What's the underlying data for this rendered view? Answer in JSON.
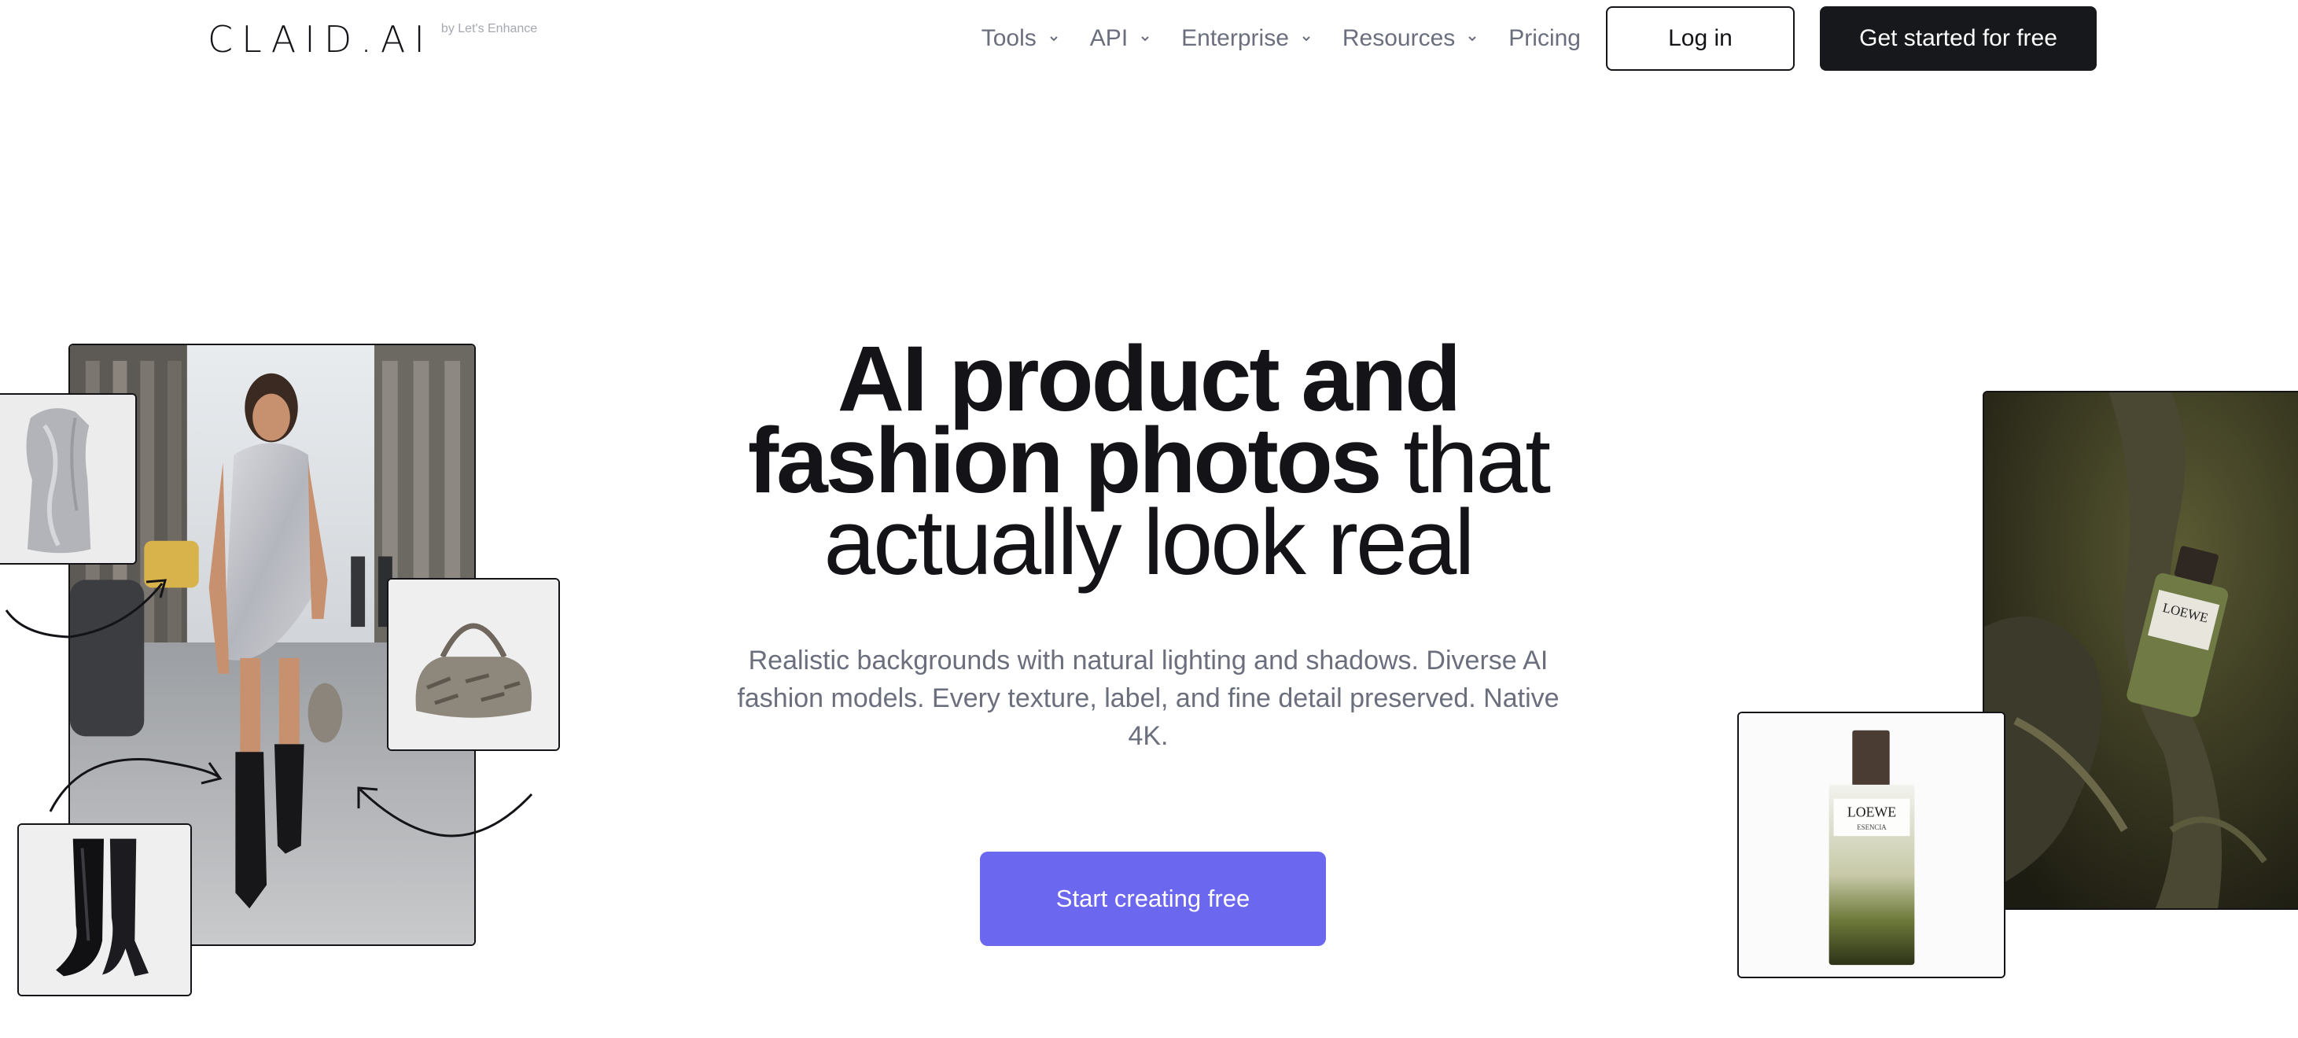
{
  "header": {
    "logo_text": "CLAID.AI",
    "logo_sub": "by Let's Enhance",
    "nav": [
      {
        "label": "Tools",
        "has_dropdown": true
      },
      {
        "label": "API",
        "has_dropdown": true
      },
      {
        "label": "Enterprise",
        "has_dropdown": true
      },
      {
        "label": "Resources",
        "has_dropdown": true
      },
      {
        "label": "Pricing",
        "has_dropdown": false
      }
    ],
    "login_label": "Log in",
    "get_started_label": "Get started for free"
  },
  "hero": {
    "title_bold_1": "AI product and",
    "title_bold_2": "fashion photos",
    "title_light_2": " that",
    "title_light_3": "actually look real",
    "subtitle": "Realistic backgrounds with natural lighting and shadows. Diverse AI fashion models. Every texture, label, and fine detail preserved. Native 4K.",
    "cta_label": "Start creating free"
  },
  "images": {
    "perfume_label": "LOEWE",
    "perfume_sublabel": "ESENCIA"
  },
  "colors": {
    "accent": "#6c67ef",
    "dark": "#17181c",
    "muted_text": "#6b6f7d"
  }
}
